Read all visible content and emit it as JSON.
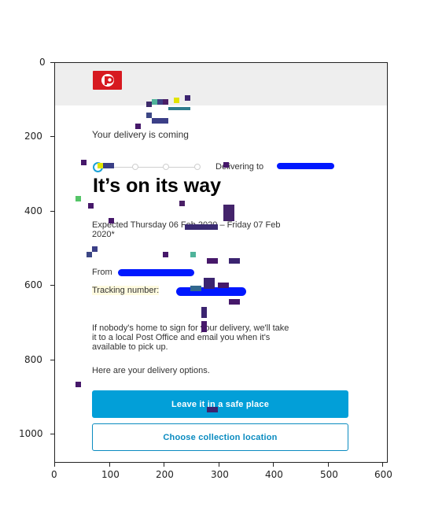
{
  "axes": {
    "x_ticks": [
      "0",
      "100",
      "200",
      "300",
      "400",
      "500",
      "600"
    ],
    "y_ticks": [
      "0",
      "200",
      "400",
      "600",
      "800",
      "1000"
    ]
  },
  "email": {
    "brand_logo": "auspost-logo",
    "header_text": "Your delivery is coming",
    "delivering_to_label": "Delivering to",
    "headline": "It’s on its way",
    "expected_line1": "Expected Thursday 06 Feb 2020 – Friday 07 Feb",
    "expected_line2": "2020*",
    "from_label": "From",
    "tracking_label": "Tracking number:",
    "body_line1": "If nobody's home to sign for your delivery, we'll take",
    "body_line2": "it to a local Post Office and email you when it's",
    "body_line3": "available to pick up.",
    "options_text": "Here are your delivery options.",
    "primary_button": "Leave it in a safe place",
    "secondary_button": "Choose collection location"
  },
  "colors": {
    "brand_red": "#d71920",
    "primary_blue": "#029fd8",
    "redaction_blue": "#0018ff"
  }
}
